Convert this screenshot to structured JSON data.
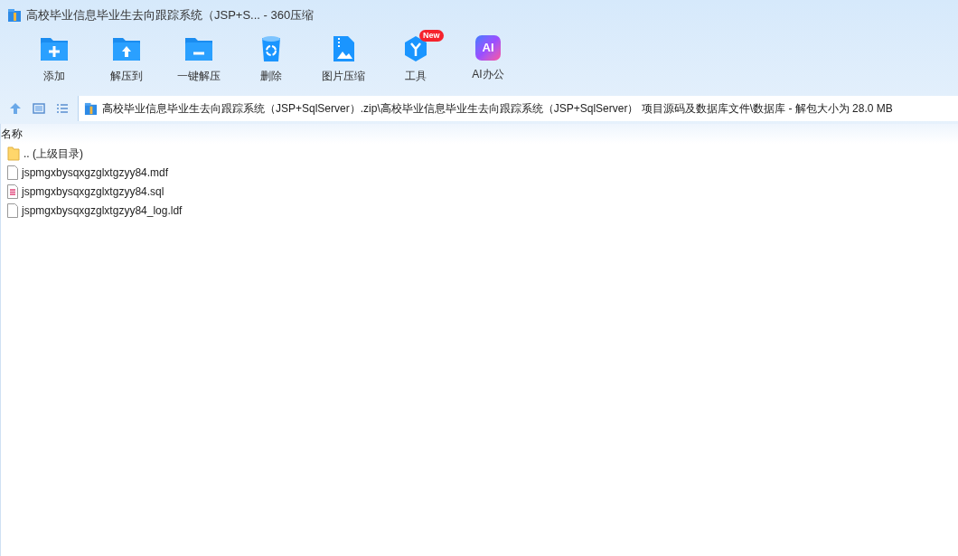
{
  "window": {
    "title": "高校毕业信息毕业生去向跟踪系统（JSP+S... - 360压缩"
  },
  "toolbar": [
    {
      "label": "添加",
      "kind": "add"
    },
    {
      "label": "解压到",
      "kind": "extract"
    },
    {
      "label": "一键解压",
      "kind": "oneclick"
    },
    {
      "label": "删除",
      "kind": "delete"
    },
    {
      "label": "图片压缩",
      "kind": "image"
    },
    {
      "label": "工具",
      "kind": "tools",
      "badge": "New"
    },
    {
      "label": "AI办公",
      "kind": "ai",
      "icon_text": "AI"
    }
  ],
  "address_bar": {
    "path": "高校毕业信息毕业生去向跟踪系统（JSP+SqlServer）.zip\\高校毕业信息毕业生去向跟踪系统（JSP+SqlServer） 项目源码及数据库文件\\数据库 - 解包大小为 28.0 MB"
  },
  "file_list": {
    "columns": [
      "名称"
    ],
    "rows": [
      {
        "name": ".. (上级目录)",
        "kind": "folder"
      },
      {
        "name": "jspmgxbysqxgzglxtgzyy84.mdf",
        "kind": "file"
      },
      {
        "name": "jspmgxbysqxgzglxtgzyy84.sql",
        "kind": "sql"
      },
      {
        "name": "jspmgxbysqxgzglxtgzyy84_log.ldf",
        "kind": "file"
      }
    ]
  }
}
